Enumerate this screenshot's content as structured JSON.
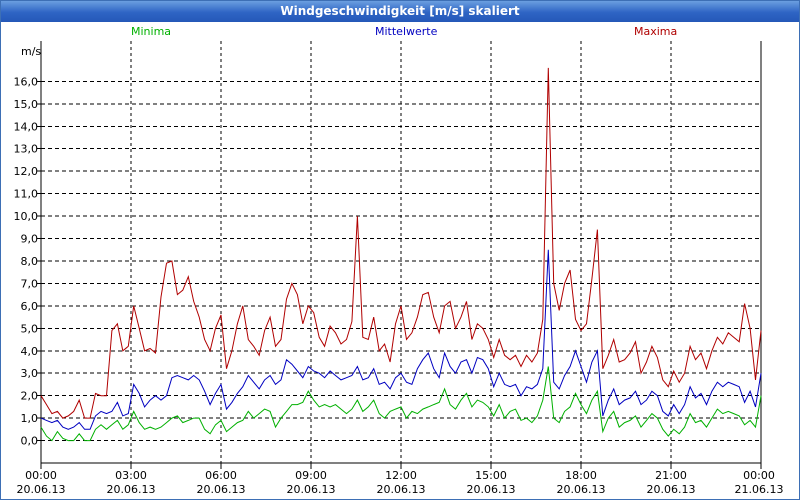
{
  "window": {
    "title": "Windgeschwindigkeit [m/s] skaliert"
  },
  "chart_data": {
    "type": "line",
    "title": "Windgeschwindigkeit [m/s] skaliert",
    "ylabel": "m/s",
    "ylim": [
      -1.0,
      17.8
    ],
    "xlim": [
      0,
      24
    ],
    "grid": true,
    "y_ticks": [
      "0,0",
      "1,0",
      "2,0",
      "3,0",
      "4,0",
      "5,0",
      "6,0",
      "7,0",
      "8,0",
      "9,0",
      "10,0",
      "11,0",
      "12,0",
      "13,0",
      "14,0",
      "15,0",
      "16,0"
    ],
    "x_ticks": [
      {
        "time": "00:00",
        "date": "20.06.13"
      },
      {
        "time": "03:00",
        "date": "20.06.13"
      },
      {
        "time": "06:00",
        "date": "20.06.13"
      },
      {
        "time": "09:00",
        "date": "20.06.13"
      },
      {
        "time": "12:00",
        "date": "20.06.13"
      },
      {
        "time": "15:00",
        "date": "20.06.13"
      },
      {
        "time": "18:00",
        "date": "20.06.13"
      },
      {
        "time": "21:00",
        "date": "20.06.13"
      },
      {
        "time": "00:00",
        "date": "21.06.13"
      }
    ],
    "series": [
      {
        "name": "Minima",
        "color": "#00b000",
        "values": [
          0.6,
          0.2,
          0.0,
          0.4,
          0.1,
          0.0,
          0.0,
          0.3,
          0.0,
          0.0,
          0.5,
          0.7,
          0.5,
          0.7,
          0.9,
          0.5,
          0.7,
          1.3,
          0.8,
          0.5,
          0.6,
          0.5,
          0.6,
          0.8,
          1.0,
          1.1,
          0.8,
          0.9,
          1.0,
          1.0,
          0.5,
          0.3,
          0.7,
          0.9,
          0.4,
          0.6,
          0.8,
          0.9,
          1.3,
          1.0,
          1.2,
          1.4,
          1.3,
          0.6,
          1.0,
          1.3,
          1.6,
          1.6,
          1.7,
          2.2,
          1.8,
          1.5,
          1.6,
          1.5,
          1.6,
          1.4,
          1.2,
          1.4,
          1.8,
          1.3,
          1.5,
          1.8,
          1.2,
          1.0,
          1.3,
          1.4,
          1.5,
          1.0,
          1.3,
          1.2,
          1.4,
          1.5,
          1.6,
          1.7,
          2.3,
          1.6,
          1.4,
          1.8,
          2.1,
          1.5,
          1.8,
          1.7,
          1.5,
          1.1,
          1.6,
          1.0,
          1.3,
          1.4,
          0.9,
          1.0,
          0.8,
          1.1,
          1.8,
          3.3,
          1.0,
          0.8,
          1.3,
          1.5,
          2.1,
          1.6,
          1.2,
          1.8,
          2.2,
          0.4,
          1.0,
          1.3,
          0.6,
          0.8,
          0.9,
          1.1,
          0.6,
          0.9,
          1.2,
          1.0,
          0.5,
          0.2,
          0.5,
          0.3,
          0.6,
          1.2,
          0.8,
          0.9,
          0.6,
          1.0,
          1.4,
          1.2,
          1.3,
          1.2,
          1.1,
          0.7,
          0.9,
          0.6,
          2.0
        ],
        "max_peak": null
      },
      {
        "name": "Mittelwerte",
        "color": "#0000c0",
        "values": [
          1.0,
          0.9,
          0.8,
          0.9,
          0.6,
          0.5,
          0.6,
          0.8,
          0.5,
          0.5,
          1.1,
          1.3,
          1.2,
          1.3,
          1.7,
          1.1,
          1.2,
          2.5,
          2.1,
          1.5,
          1.8,
          2.0,
          1.8,
          2.0,
          2.8,
          2.9,
          2.8,
          2.7,
          2.9,
          2.7,
          2.2,
          1.6,
          2.1,
          2.5,
          1.4,
          1.7,
          2.1,
          2.4,
          2.9,
          2.6,
          2.3,
          2.7,
          2.9,
          2.5,
          2.7,
          3.6,
          3.4,
          3.1,
          2.8,
          3.3,
          3.1,
          3.0,
          2.8,
          3.1,
          2.9,
          2.7,
          2.8,
          2.9,
          3.3,
          2.7,
          2.8,
          3.2,
          2.5,
          2.6,
          2.3,
          2.8,
          3.0,
          2.6,
          2.5,
          3.2,
          3.6,
          3.9,
          3.2,
          2.8,
          3.9,
          3.3,
          3.0,
          3.5,
          3.6,
          3.0,
          3.7,
          3.6,
          3.2,
          2.4,
          3.0,
          2.5,
          2.4,
          2.5,
          2.0,
          2.4,
          2.3,
          2.5,
          3.2,
          8.5,
          2.6,
          2.3,
          2.9,
          3.3,
          4.0,
          3.3,
          2.6,
          3.5,
          4.0,
          1.1,
          1.8,
          2.3,
          1.6,
          1.8,
          1.9,
          2.2,
          1.6,
          1.8,
          2.2,
          2.0,
          1.3,
          1.1,
          1.6,
          1.2,
          1.6,
          2.4,
          1.9,
          2.1,
          1.6,
          2.2,
          2.6,
          2.4,
          2.6,
          2.5,
          2.4,
          1.7,
          2.2,
          1.5,
          3.0
        ],
        "max_peak": null
      },
      {
        "name": "Maxima",
        "color": "#b00000",
        "values": [
          2.0,
          1.6,
          1.2,
          1.3,
          1.0,
          1.1,
          1.3,
          1.8,
          1.0,
          1.0,
          2.1,
          2.0,
          2.0,
          4.9,
          5.2,
          4.0,
          4.2,
          6.0,
          5.0,
          4.0,
          4.1,
          3.9,
          6.4,
          7.9,
          8.0,
          6.5,
          6.7,
          7.3,
          6.2,
          5.5,
          4.5,
          4.0,
          5.0,
          5.6,
          3.2,
          4.0,
          5.2,
          6.0,
          4.5,
          4.2,
          3.8,
          4.9,
          5.5,
          4.2,
          4.5,
          6.3,
          7.0,
          6.5,
          5.2,
          6.0,
          5.7,
          4.6,
          4.2,
          5.1,
          4.8,
          4.3,
          4.5,
          5.3,
          10.0,
          4.6,
          4.5,
          5.5,
          4.0,
          4.3,
          3.5,
          5.2,
          6.0,
          4.5,
          4.8,
          5.5,
          6.5,
          6.6,
          5.5,
          4.8,
          6.0,
          6.2,
          5.0,
          5.5,
          6.2,
          4.5,
          5.2,
          5.0,
          4.5,
          3.7,
          4.5,
          3.8,
          3.6,
          3.8,
          3.3,
          3.8,
          3.5,
          3.9,
          5.4,
          16.6,
          7.0,
          5.8,
          7.0,
          7.6,
          5.4,
          4.9,
          5.2,
          7.2,
          9.4,
          3.2,
          3.8,
          4.5,
          3.5,
          3.6,
          3.9,
          4.4,
          3.0,
          3.5,
          4.2,
          3.7,
          2.7,
          2.4,
          3.1,
          2.6,
          3.0,
          4.2,
          3.6,
          3.9,
          3.2,
          4.0,
          4.6,
          4.3,
          4.8,
          4.6,
          4.4,
          6.1,
          5.0,
          2.7,
          4.9
        ],
        "max_peak": null
      }
    ]
  }
}
